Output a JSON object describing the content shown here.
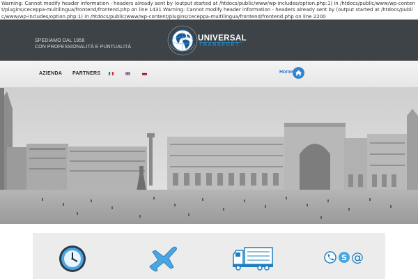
{
  "warning": {
    "text": "Warning: Cannot modify header information - headers already sent by (output started at /htdocs/public/www/wp-includes/option.php:1) in /htdocs/public/www/wp-content/plugins/ceceppa-multilingua/frontend/frontend.php on line 1431 Warning: Cannot modify header information - headers already sent by (output started at /htdocs/public/www/wp-includes/option.php:1) in /htdocs/public/www/wp-content/plugins/ceceppa-multilingua/frontend/frontend.php on line 2200"
  },
  "header": {
    "tagline_line1": "SPEDIAMO DAL 1958",
    "tagline_line2": "CON PROFESSIONALITÀ E PUNTUALITÀ",
    "logo": {
      "word1": "UNIVERSAL",
      "word2": "TRANSPORT",
      "ring_text": "INTERNATIONAL FORWARDERS"
    },
    "colors": {
      "bar": "#3d4347",
      "accent": "#1e88c8"
    }
  },
  "nav": {
    "items": [
      {
        "label": "AZIENDA"
      },
      {
        "label": "PARTNERS"
      }
    ],
    "languages": [
      {
        "code": "it",
        "icon": "italian-flag-icon"
      },
      {
        "code": "en",
        "icon": "uk-flag-icon"
      },
      {
        "code": "ru",
        "icon": "russian-flag-icon"
      }
    ],
    "home_label": "Home",
    "home_icon": "home-icon"
  },
  "hero": {
    "description_icon": "milan-galleria-photo"
  },
  "features": {
    "items": [
      {
        "icon": "clock-icon"
      },
      {
        "icon": "airplane-icon"
      },
      {
        "icon": "truck-icon"
      },
      {
        "icon": "contact-icons"
      }
    ]
  }
}
